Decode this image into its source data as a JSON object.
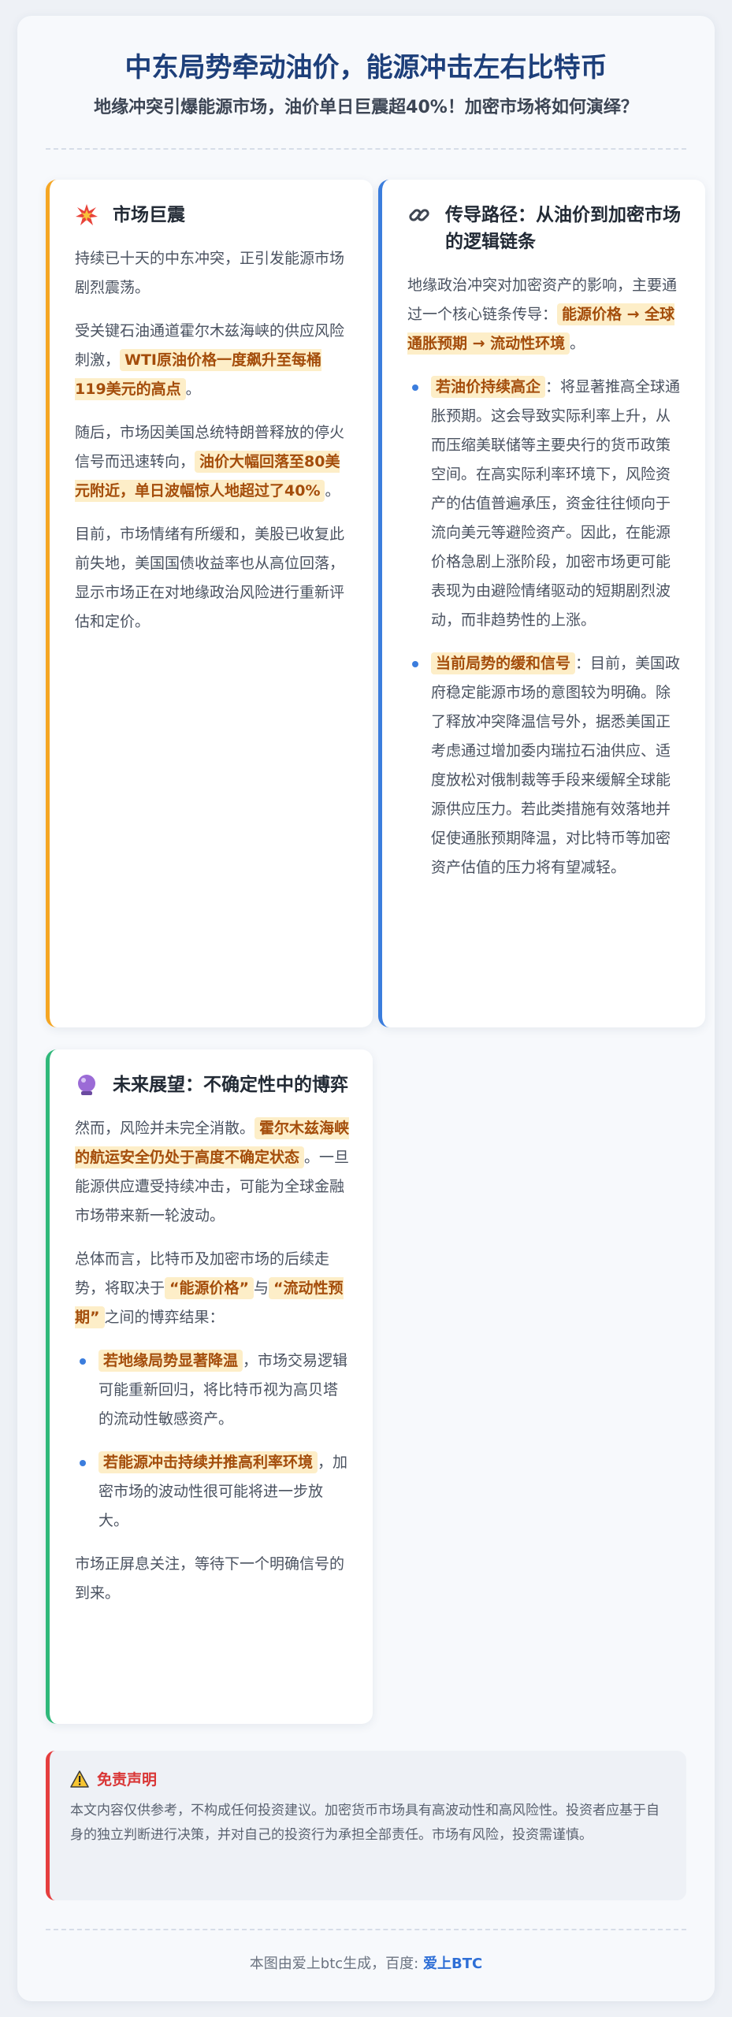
{
  "header": {
    "title": "中东局势牵动油价，能源冲击左右比特币",
    "subtitle": "地缘冲突引爆能源市场，油价单日巨震超40%！加密市场将如何演绎？"
  },
  "card_market": {
    "title": "市场巨震",
    "icon": "explosion-icon",
    "p1": "持续已十天的中东冲突，正引发能源市场剧烈震荡。",
    "p2_a": "受关键石油通道霍尔木兹海峡的供应风险刺激，",
    "p2_hl": "WTI原油价格一度飙升至每桶119美元的高点",
    "p2_b": "。",
    "p3_a": "随后，市场因美国总统特朗普释放的停火信号而迅速转向，",
    "p3_hl": "油价大幅回落至80美元附近，单日波幅惊人地超过了40%",
    "p3_b": "。",
    "p4": "目前，市场情绪有所缓和，美股已收复此前失地，美国国债收益率也从高位回落，显示市场正在对地缘政治风险进行重新评估和定价。"
  },
  "card_path": {
    "title": "传导路径：从油价到加密市场的逻辑链条",
    "icon": "link-icon",
    "intro_a": "地缘政治冲突对加密资产的影响，主要通过一个核心链条传导：",
    "intro_hl": "能源价格 → 全球通胀预期 → 流动性环境",
    "intro_b": "。",
    "b1_hl": "若油价持续高企",
    "b1_text": "：将显著推高全球通胀预期。这会导致实际利率上升，从而压缩美联储等主要央行的货币政策空间。在高实际利率环境下，风险资产的估值普遍承压，资金往往倾向于流向美元等避险资产。因此，在能源价格急剧上涨阶段，加密市场更可能表现为由避险情绪驱动的短期剧烈波动，而非趋势性的上涨。",
    "b2_hl": "当前局势的缓和信号",
    "b2_text": "：目前，美国政府稳定能源市场的意图较为明确。除了释放冲突降温信号外，据悉美国正考虑通过增加委内瑞拉石油供应、适度放松对俄制裁等手段来缓解全球能源供应压力。若此类措施有效落地并促使通胀预期降温，对比特币等加密资产估值的压力将有望减轻。"
  },
  "card_outlook": {
    "title": "未来展望：不确定性中的博弈",
    "icon": "crystal-ball-icon",
    "p1_a": "然而，风险并未完全消散。",
    "p1_hl": "霍尔木兹海峡的航运安全仍处于高度不确定状态",
    "p1_b": "。一旦能源供应遭受持续冲击，可能为全球金融市场带来新一轮波动。",
    "p2_a": "总体而言，比特币及加密市场的后续走势，将取决于",
    "p2_hl1": "“能源价格”",
    "p2_mid": "与",
    "p2_hl2": "“流动性预期”",
    "p2_b": "之间的博弈结果：",
    "b1_hl": "若地缘局势显著降温",
    "b1_text": "，市场交易逻辑可能重新回归，将比特币视为高贝塔的流动性敏感资产。",
    "b2_hl": "若能源冲击持续并推高利率环境",
    "b2_text": "，加密市场的波动性很可能将进一步放大。",
    "p3": "市场正屏息关注，等待下一个明确信号的到来。"
  },
  "disclaimer": {
    "icon": "warning-icon",
    "title": "免责声明",
    "text": "本文内容仅供参考，不构成任何投资建议。加密货币市场具有高波动性和高风险性。投资者应基于自身的独立判断进行决策，并对自己的投资行为承担全部责任。市场有风险，投资需谨慎。"
  },
  "footer": {
    "text": "本图由爱上btc生成，百度: ",
    "brand": "爱上BTC"
  },
  "colors": {
    "title_blue": "#1d3f7a",
    "orange_accent": "#f5a623",
    "blue_accent": "#3b7ddd",
    "green_accent": "#2fb87a",
    "red_accent": "#e53e3e",
    "highlight_bg": "#fdeec8",
    "highlight_text": "#a44d0b"
  }
}
